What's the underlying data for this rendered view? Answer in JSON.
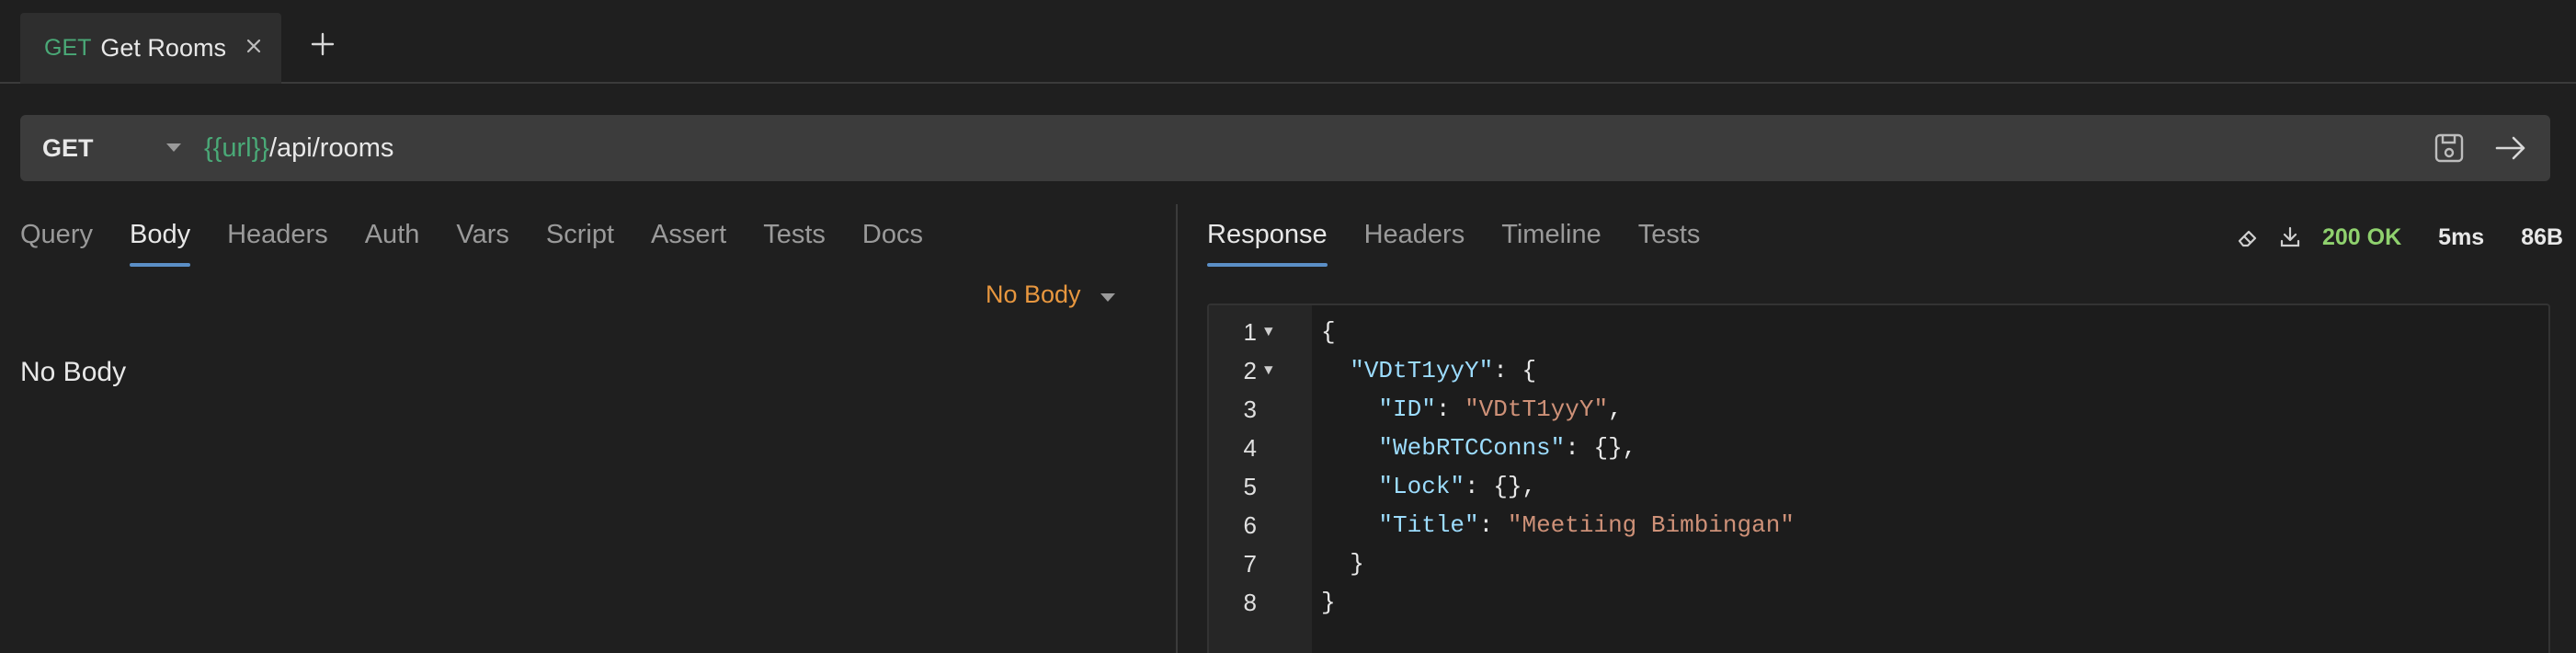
{
  "tabs": [
    {
      "method": "GET",
      "name": "Get Rooms"
    }
  ],
  "request": {
    "method": "GET",
    "url_var": "{{url}}",
    "url_path": "/api/rooms",
    "tabs": [
      "Query",
      "Body",
      "Headers",
      "Auth",
      "Vars",
      "Script",
      "Assert",
      "Tests",
      "Docs"
    ],
    "active_tab": "Body",
    "body_mode": "No Body",
    "body_content": "No Body"
  },
  "response": {
    "tabs": [
      "Response",
      "Headers",
      "Timeline",
      "Tests"
    ],
    "active_tab": "Response",
    "status": "200 OK",
    "time": "5ms",
    "size": "86B",
    "lines": [
      {
        "num": "1",
        "fold": "▼",
        "parts": [
          [
            "p",
            "{"
          ]
        ]
      },
      {
        "num": "2",
        "fold": "▼",
        "parts": [
          [
            "p",
            "  "
          ],
          [
            "k",
            "\"VDtT1yyY\""
          ],
          [
            "p",
            ": {"
          ]
        ]
      },
      {
        "num": "3",
        "fold": "",
        "parts": [
          [
            "p",
            "    "
          ],
          [
            "k",
            "\"ID\""
          ],
          [
            "p",
            ": "
          ],
          [
            "s",
            "\"VDtT1yyY\""
          ],
          [
            "p",
            ","
          ]
        ]
      },
      {
        "num": "4",
        "fold": "",
        "parts": [
          [
            "p",
            "    "
          ],
          [
            "k",
            "\"WebRTCConns\""
          ],
          [
            "p",
            ": {},"
          ]
        ]
      },
      {
        "num": "5",
        "fold": "",
        "parts": [
          [
            "p",
            "    "
          ],
          [
            "k",
            "\"Lock\""
          ],
          [
            "p",
            ": {},"
          ]
        ]
      },
      {
        "num": "6",
        "fold": "",
        "parts": [
          [
            "p",
            "    "
          ],
          [
            "k",
            "\"Title\""
          ],
          [
            "p",
            ": "
          ],
          [
            "s",
            "\"Meetiing Bimbingan\""
          ]
        ]
      },
      {
        "num": "7",
        "fold": "",
        "parts": [
          [
            "p",
            "  }"
          ]
        ]
      },
      {
        "num": "8",
        "fold": "",
        "parts": [
          [
            "p",
            "}"
          ]
        ]
      }
    ]
  },
  "colors": {
    "accent_green": "#4aa977",
    "status_ok": "#8fd16e",
    "body_mode_orange": "#e8973f",
    "active_underline": "#5b8fc7"
  },
  "icons": {
    "tab_close": "close-icon",
    "new_tab": "plus-icon",
    "method_dropdown": "caret-down-icon",
    "save": "save-icon",
    "send": "arrow-right-icon",
    "clear": "eraser-icon",
    "download": "download-icon"
  }
}
